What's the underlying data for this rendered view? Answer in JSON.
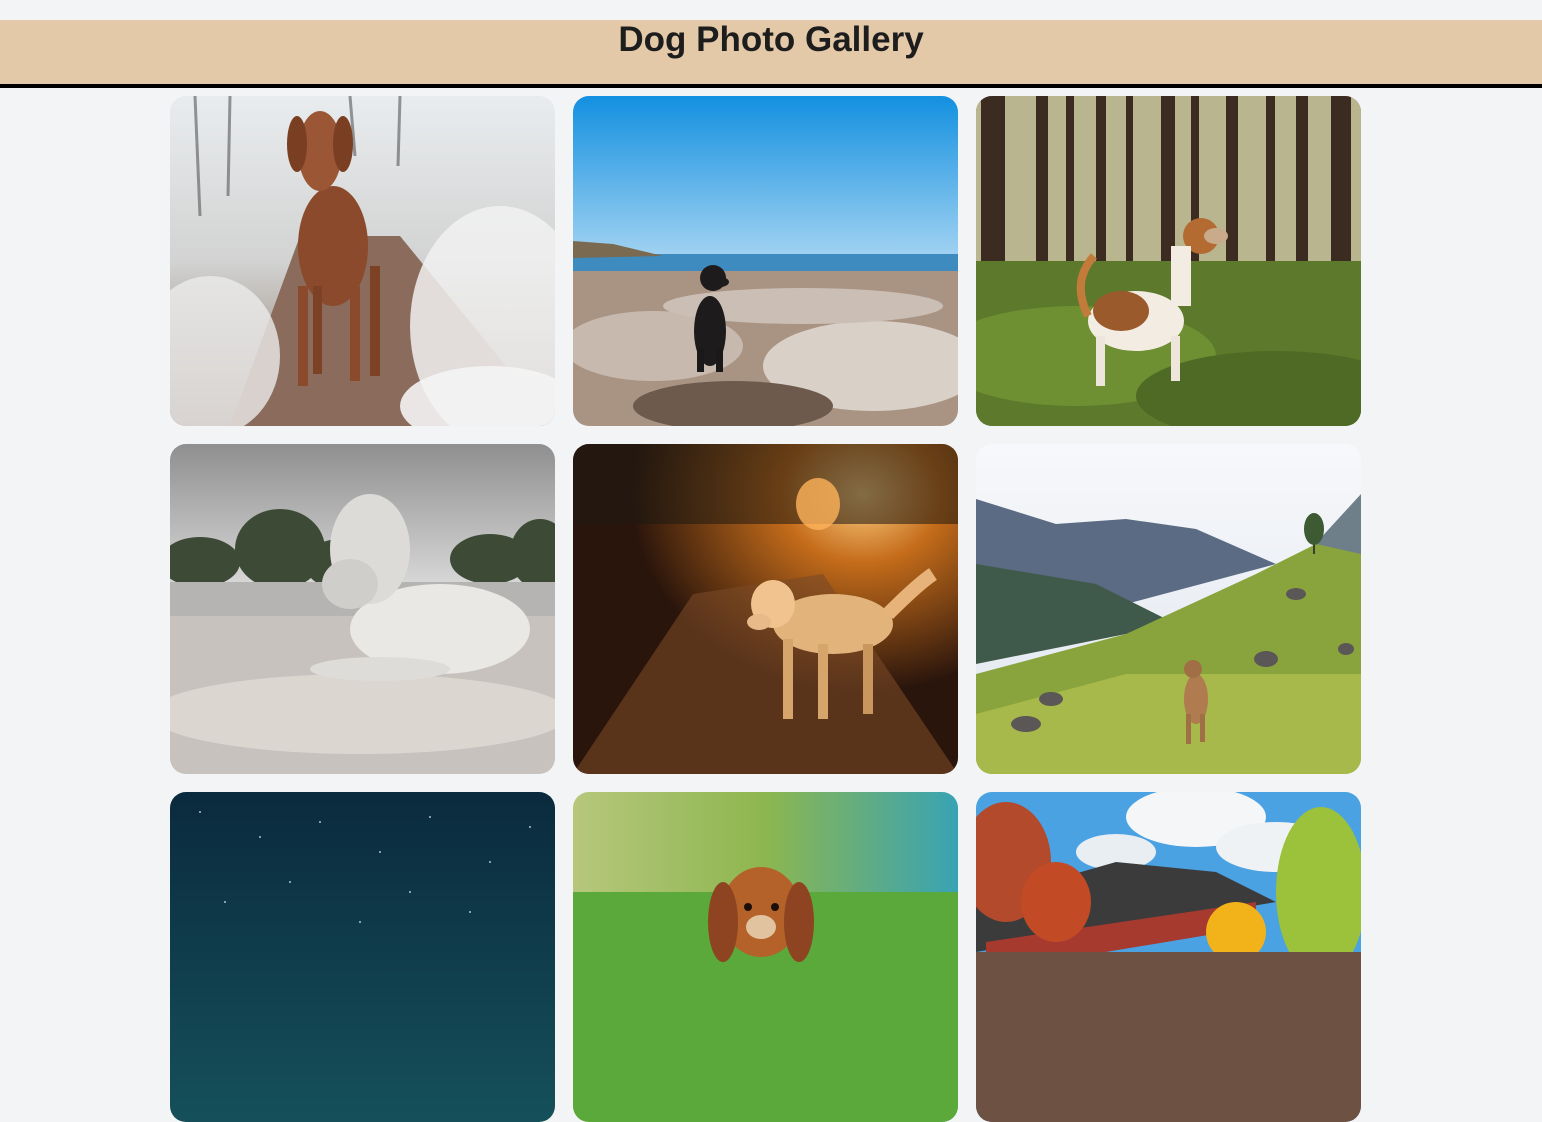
{
  "header": {
    "title": "Dog Photo Gallery"
  },
  "gallery": {
    "photos": [
      {
        "subject": "Vizsla dog standing on frosty forest path"
      },
      {
        "subject": "Black dog sitting on rocky shore under blue sky"
      },
      {
        "subject": "Jack Russell terrier in pine forest grass"
      },
      {
        "subject": "White curly dog lying on sandy beach by lake"
      },
      {
        "subject": "Golden retriever walking in golden sunset light"
      },
      {
        "subject": "Small brown dog on green mountain meadow"
      },
      {
        "subject": "Starry night sky"
      },
      {
        "subject": "Cavalier King Charles spaniel in green grass"
      },
      {
        "subject": "Traditional temple roof with autumn trees"
      }
    ]
  },
  "colors": {
    "header_bg": "#e4c9a9",
    "page_bg": "#f3f4f6",
    "header_border": "#000000"
  }
}
